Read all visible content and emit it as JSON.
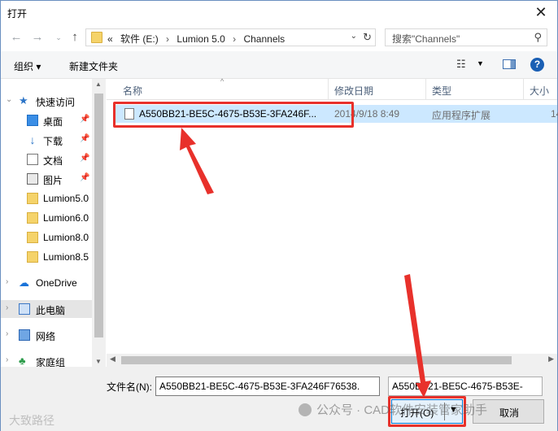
{
  "window": {
    "title": "打开"
  },
  "address": {
    "breadcrumbs": [
      "«",
      "软件 (E:)",
      "›",
      "Lumion 5.0",
      "›",
      "Channels"
    ],
    "search_placeholder": "搜索\"Channels\""
  },
  "toolbar": {
    "organize": "组织 ▾",
    "new_folder": "新建文件夹"
  },
  "nav": {
    "quick_access": "快速访问",
    "items": [
      {
        "label": "桌面",
        "pinned": true
      },
      {
        "label": "下载",
        "pinned": true
      },
      {
        "label": "文档",
        "pinned": true
      },
      {
        "label": "图片",
        "pinned": true
      },
      {
        "label": "Lumion5.0"
      },
      {
        "label": "Lumion6.0"
      },
      {
        "label": "Lumion8.0"
      },
      {
        "label": "Lumion8.5"
      }
    ],
    "onedrive": "OneDrive",
    "this_pc": "此电脑",
    "network": "网络",
    "homegroup": "家庭组"
  },
  "columns": {
    "name": "名称",
    "date": "修改日期",
    "type": "类型",
    "size": "大小"
  },
  "files": [
    {
      "name": "A550BB21-BE5C-4675-B53E-3FA246F...",
      "date": "2014/9/18 8:49",
      "type": "应用程序扩展",
      "size": "14"
    }
  ],
  "footer": {
    "filename_label": "文件名(N):",
    "filename_value": "A550BB21-BE5C-4675-B53E-3FA246F76538.",
    "filter_value": "A550BB21-BE5C-4675-B53E-",
    "open_label": "打开(O)",
    "cancel_label": "取消"
  },
  "watermark": {
    "line1": "公众号 · CAD软件安装管家助手",
    "line2": "大致路径"
  },
  "colors": {
    "highlight": "#e8312b",
    "selection": "#cce8ff",
    "accent": "#0078d7"
  }
}
